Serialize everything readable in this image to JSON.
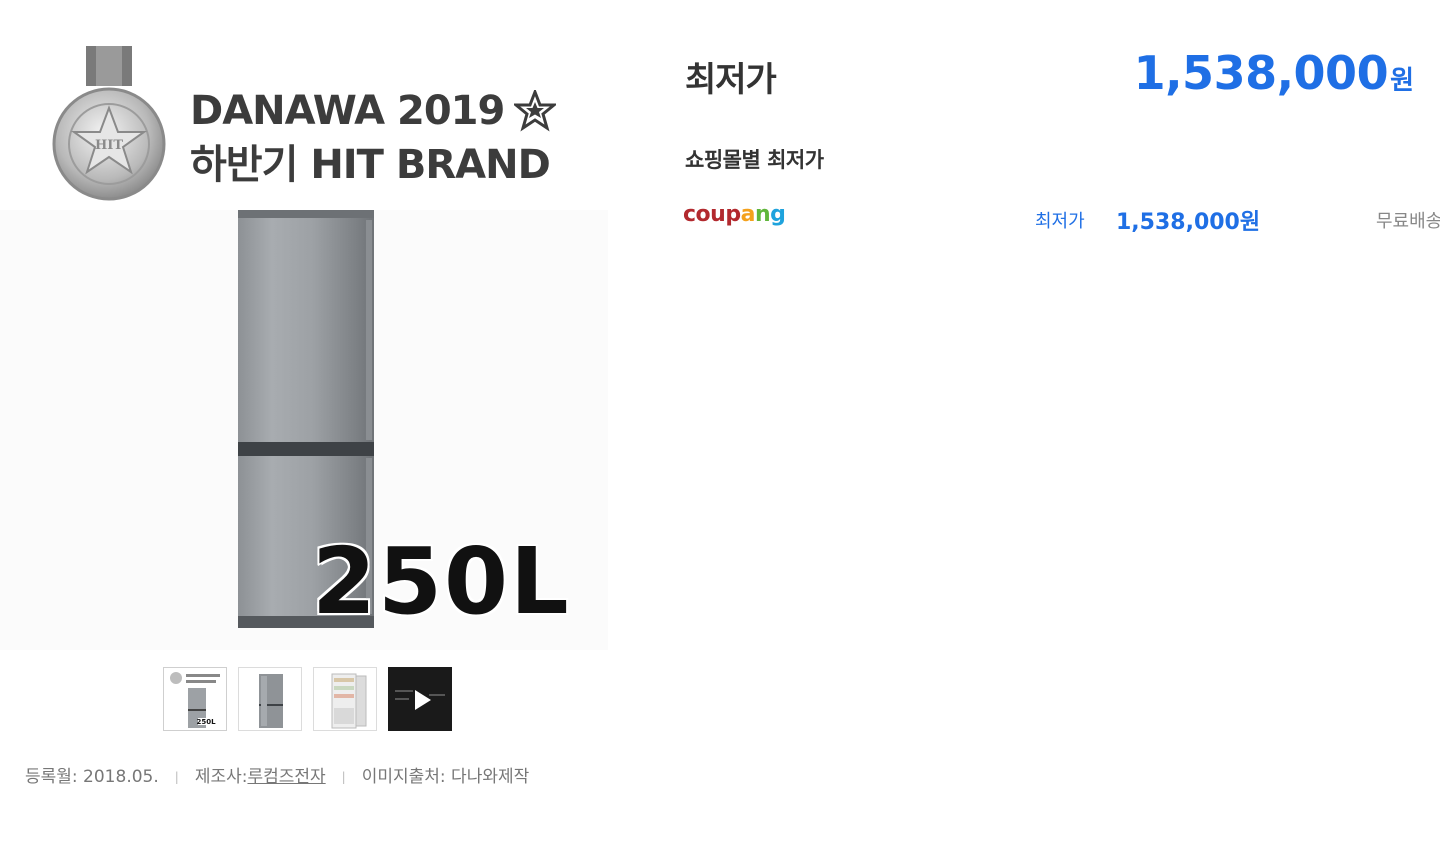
{
  "award": {
    "line1": "DANAWA 2019",
    "line2": "하반기 HIT BRAND"
  },
  "product": {
    "capacity_label": "250L"
  },
  "meta": {
    "registered": "등록월: 2018.05.",
    "maker_label": "제조사:",
    "maker_name": "루컴즈전자",
    "image_source": "이미지출처: 다나와제작"
  },
  "price": {
    "title": "최저가",
    "amount": "1,538,000",
    "currency": "원"
  },
  "mall_section": {
    "title": "쇼핑몰별 최저가",
    "rows": [
      {
        "mall_letters": [
          "c",
          "o",
          "u",
          "p",
          "a",
          "n",
          "g"
        ],
        "lowest_label": "최저가",
        "price": "1,538,000원",
        "delivery": "무료배송"
      }
    ]
  },
  "colors": {
    "price_blue": "#1f6fe5",
    "coupang": [
      "#b2292e",
      "#b2292e",
      "#b2292e",
      "#b2292e",
      "#f4a11c",
      "#60b63b",
      "#1fa3dd"
    ]
  }
}
